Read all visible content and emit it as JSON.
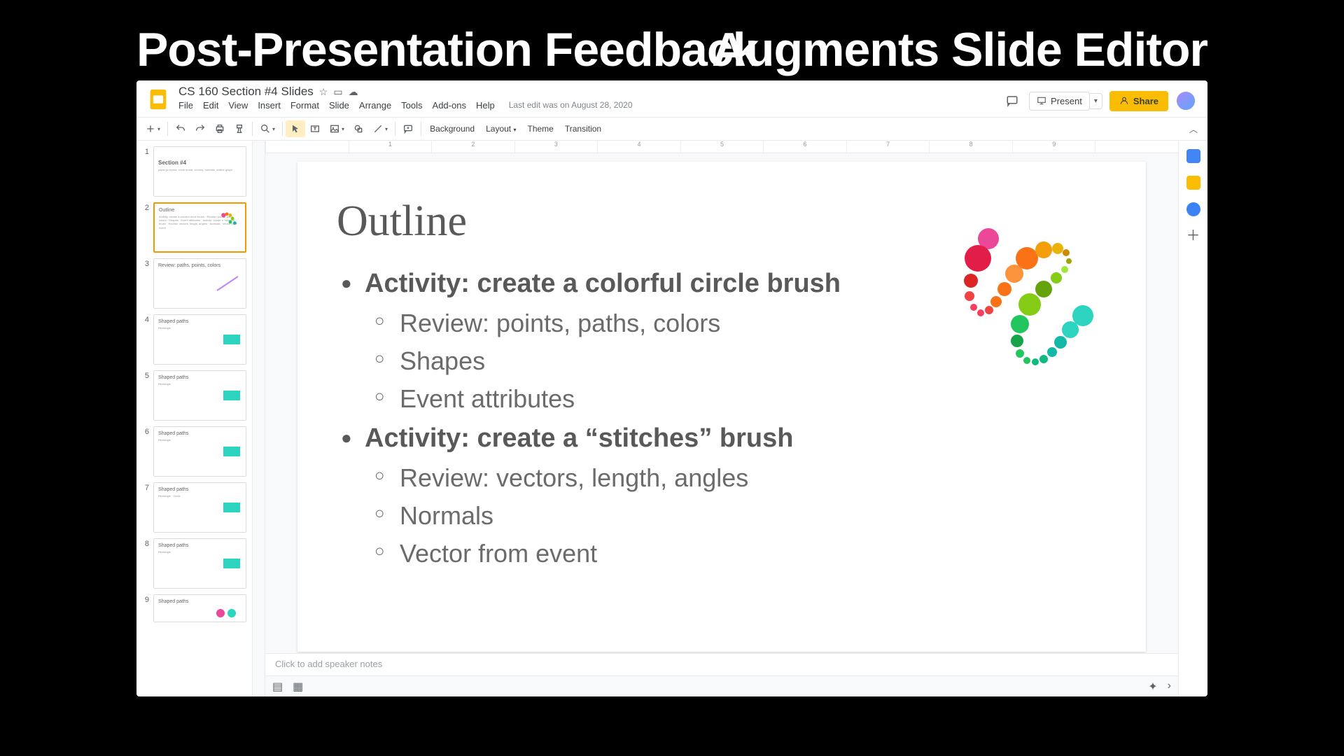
{
  "overlay": {
    "left": "Post-Presentation Feedback",
    "right": "Augments Slide Editor"
  },
  "doc": {
    "title": "CS 160 Section #4 Slides",
    "last_edit": "Last edit was on August 28, 2020"
  },
  "menu": {
    "file": "File",
    "edit": "Edit",
    "view": "View",
    "insert": "Insert",
    "format": "Format",
    "slide": "Slide",
    "arrange": "Arrange",
    "tools": "Tools",
    "addons": "Add-ons",
    "help": "Help"
  },
  "titlebar": {
    "present": "Present",
    "share": "Share"
  },
  "toolbar": {
    "background": "Background",
    "layout": "Layout",
    "theme": "Theme",
    "transition": "Transition"
  },
  "ruler": [
    "",
    "1",
    "2",
    "3",
    "4",
    "5",
    "6",
    "7",
    "8",
    "9",
    ""
  ],
  "thumbs": [
    {
      "n": "1",
      "title": "Section #4",
      "sub": "paper.js review, circle brush, vectors, normals, outline graph",
      "kind": "title"
    },
    {
      "n": "2",
      "title": "Outline",
      "sub": "Activity: create a colorful circle brush · Review: points, paths, colors · Shapes · Event attributes · Activity: create a \"stitches\" brush · Review: vectors, length, angles · Normals · Vector from event",
      "kind": "outline"
    },
    {
      "n": "3",
      "title": "Review: paths, points, colors",
      "sub": "",
      "kind": "code-line"
    },
    {
      "n": "4",
      "title": "Shaped paths",
      "sub": "Rectangle",
      "kind": "code"
    },
    {
      "n": "5",
      "title": "Shaped paths",
      "sub": "Rectangle",
      "kind": "code"
    },
    {
      "n": "6",
      "title": "Shaped paths",
      "sub": "Rectangle",
      "kind": "code"
    },
    {
      "n": "7",
      "title": "Shaped paths",
      "sub": "Rectangle · Circle",
      "kind": "code"
    },
    {
      "n": "8",
      "title": "Shaped paths",
      "sub": "Rectangle",
      "kind": "code"
    },
    {
      "n": "9",
      "title": "Shaped paths",
      "sub": "",
      "kind": "dots"
    }
  ],
  "slide": {
    "title": "Outline",
    "b1": "Activity: create a colorful circle brush",
    "b1a": "Review: points, paths, colors",
    "b1b": "Shapes",
    "b1c": "Event attributes",
    "b2": "Activity: create a “stitches” brush",
    "b2a": "Review: vectors, length, angles",
    "b2b": "Normals",
    "b2c": "Vector from event"
  },
  "speaker": {
    "placeholder": "Click to add speaker notes"
  },
  "colors": {
    "accent": "#fbbc04",
    "swatch": "#2dd4bf"
  }
}
